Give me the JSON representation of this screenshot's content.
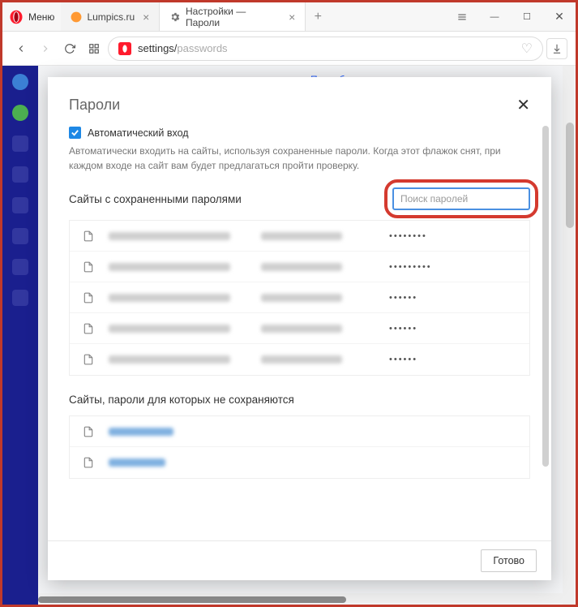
{
  "titlebar": {
    "menu_label": "Меню",
    "tabs": [
      {
        "label": "Lumpics.ru"
      },
      {
        "label": "Настройки — Пароли"
      }
    ]
  },
  "addressbar": {
    "prefix": "settings/",
    "path": "passwords"
  },
  "background": {
    "link_text": "Подробнее..."
  },
  "modal": {
    "title": "Пароли",
    "auto_signin_label": "Автоматический вход",
    "auto_signin_desc": "Автоматически входить на сайты, используя сохраненные пароли. Когда этот флажок снят, при каждом входе на сайт вам будет предлагаться пройти проверку.",
    "saved_section_title": "Сайты с сохраненными паролями",
    "search_placeholder": "Поиск паролей",
    "never_section_title": "Сайты, пароли для которых не сохраняются",
    "done_label": "Готово",
    "saved_rows": [
      {
        "password_mask": "••••••••"
      },
      {
        "password_mask": "•••••••••"
      },
      {
        "password_mask": "••••••"
      },
      {
        "password_mask": "••••••"
      },
      {
        "password_mask": "••••••"
      }
    ],
    "never_rows": [
      {},
      {}
    ]
  }
}
